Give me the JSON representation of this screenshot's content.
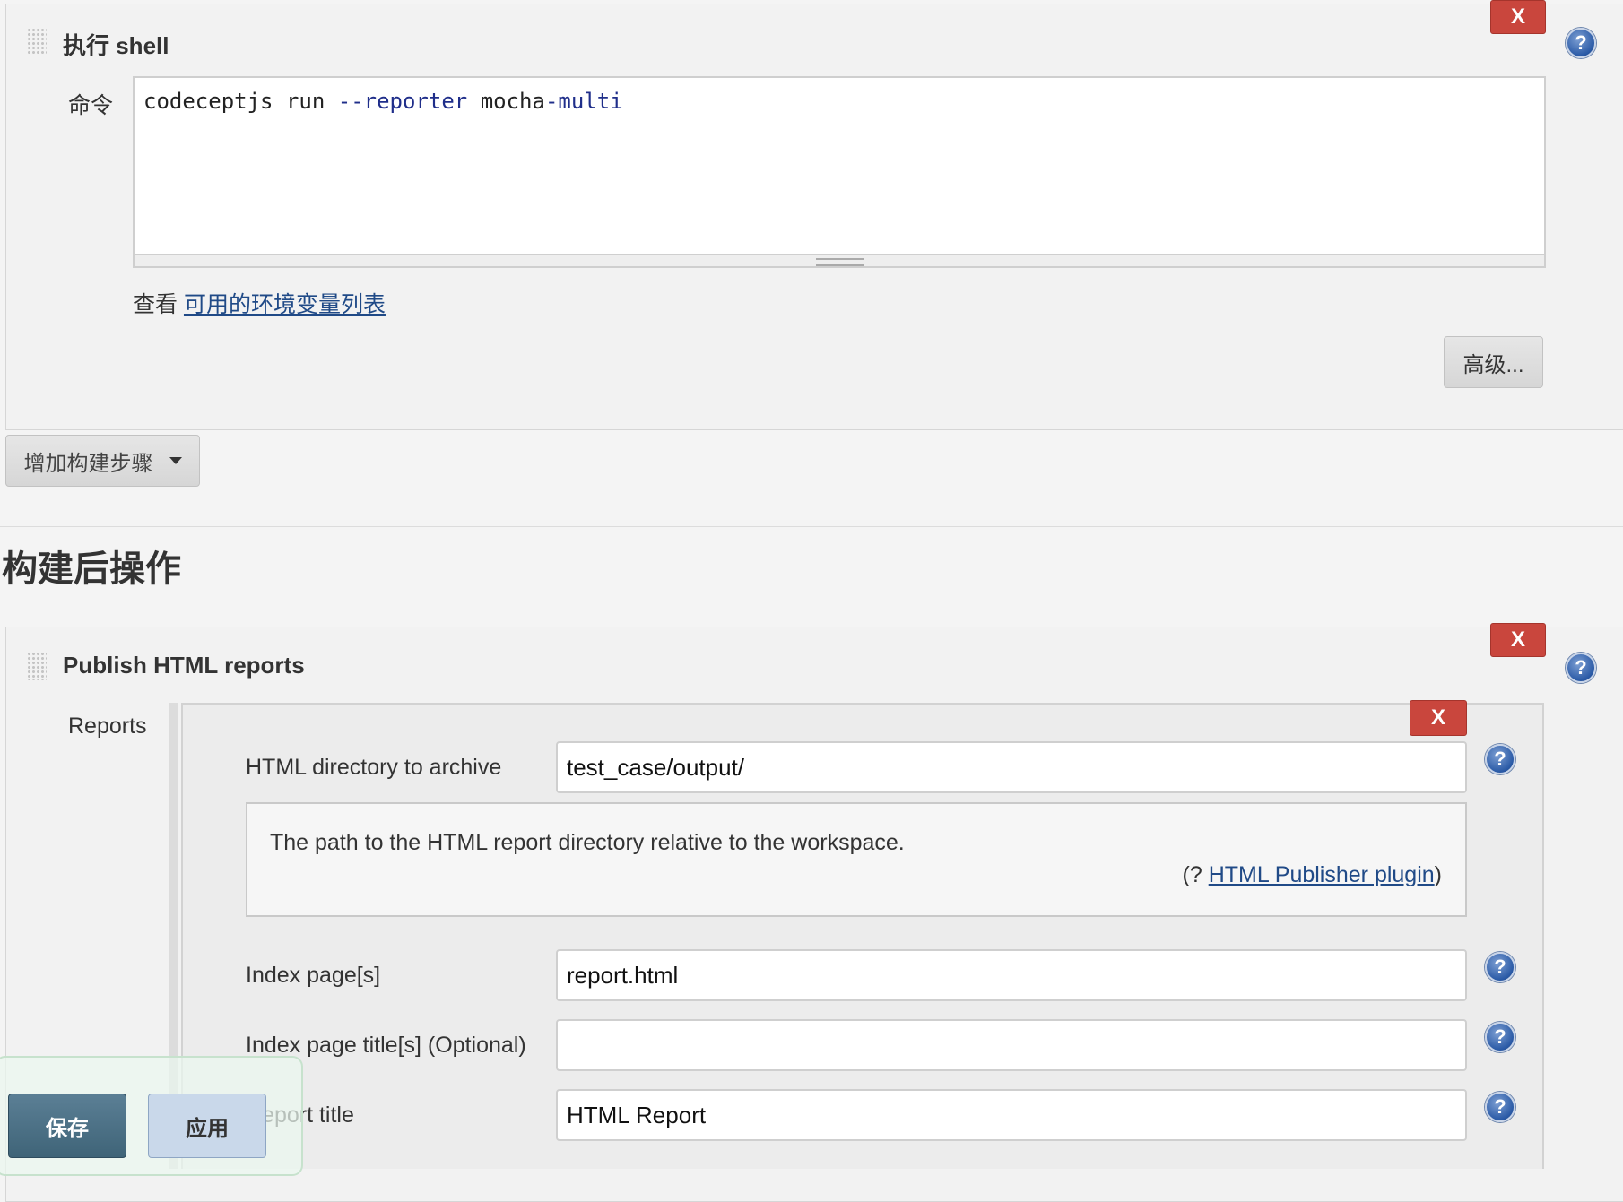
{
  "shell_step": {
    "title": "执行 shell",
    "delete_label": "X",
    "command_label": "命令",
    "command_parts": {
      "p1": "codeceptjs run ",
      "p2": "--reporter",
      "p3": " mocha",
      "p4": "-multi"
    },
    "env_prefix": "查看 ",
    "env_link": "可用的环境变量列表",
    "advanced_button": "高级..."
  },
  "add_build_step_button": "增加构建步骤",
  "post_build": {
    "heading": "构建后操作"
  },
  "publisher": {
    "title": "Publish HTML reports",
    "delete_label": "X",
    "reports_label": "Reports",
    "report_delete_label": "X",
    "fields": {
      "directory": {
        "label": "HTML directory to archive",
        "value": "test_case/output/"
      },
      "index": {
        "label": "Index page[s]",
        "value": "report.html"
      },
      "index_title": {
        "label": "Index page title[s] (Optional)",
        "value": ""
      },
      "report_title": {
        "label": "Report title",
        "value": "HTML Report"
      }
    },
    "help": {
      "text": "The path to the HTML report directory relative to the workspace.",
      "plugin_prefix": "(? ",
      "plugin_link": "HTML Publisher plugin",
      "plugin_suffix": ")"
    }
  },
  "footer": {
    "save_button": "保存",
    "apply_button": "应用"
  },
  "icons": {
    "help": "help-icon",
    "drag": "drag-handle-icon",
    "dropdown": "caret-down-icon"
  }
}
